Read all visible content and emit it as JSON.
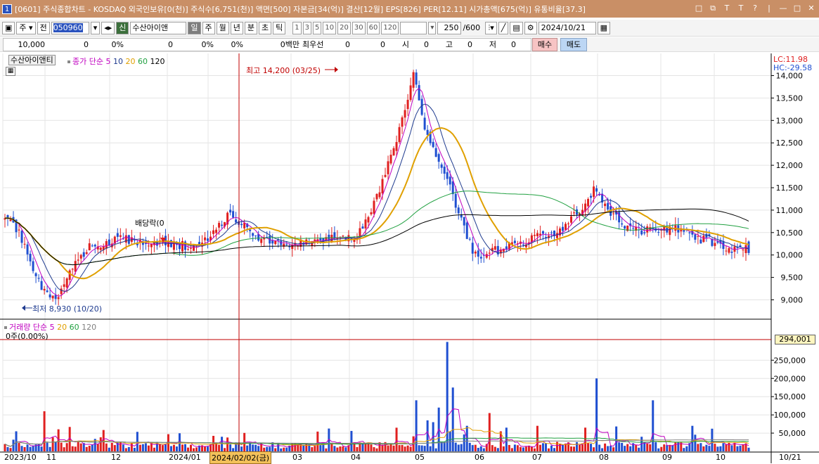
{
  "titlebar": {
    "icon_label": "1",
    "title": "[0601] 주식종합차트 - KOSDAQ 외국인보유[0(천)] 주식수[6,751(천)] 액면[500] 자본금[34(억)] 결산[12월] EPS[826] PER[12.11] 시가총액[675(억)] 유통비율[37.3]",
    "controls": [
      "□",
      "⧉",
      "T",
      "T",
      "?",
      "|",
      "—",
      "□",
      "✕"
    ]
  },
  "toolbar": {
    "period_select": "주",
    "prev_label": "전",
    "code": "050960",
    "shin_label": "신",
    "stock_name": "수산아이앤",
    "tabs": [
      "일",
      "주",
      "월",
      "년",
      "분",
      "초",
      "틱"
    ],
    "active_tab": "일",
    "intervals": [
      "1",
      "3",
      "5",
      "10",
      "20",
      "30",
      "60",
      "120"
    ],
    "count": "250",
    "count_total": "/600",
    "date": "2024/10/21"
  },
  "infobar": {
    "price": "10,000",
    "change": "0",
    "rate": "0%",
    "v1": "0",
    "rate2": "0%",
    "rate3": "0%",
    "amount": "0백만",
    "priority_label": "최우선",
    "p1": "0",
    "p2": "0",
    "open_label": "시",
    "open": "0",
    "high_label": "고",
    "high": "0",
    "low_label": "저",
    "low": "0",
    "buy_label": "매수",
    "sell_label": "매도"
  },
  "price_panel": {
    "stock_label": "수산아이앤티",
    "ma_legend": {
      "prefix": "종가 단순",
      "periods": [
        "5",
        "10",
        "20",
        "60",
        "120"
      ]
    },
    "lc_label": "LC:11.98",
    "hc_label": "HC:-29.58",
    "high_annotation": "최고 14,200 (03/25)",
    "low_annotation": "최저 8,930 (10/20)",
    "dividend_label": "배당락(0"
  },
  "volume_panel": {
    "legend": {
      "prefix": "거래량 단순",
      "periods": [
        "5",
        "20",
        "60",
        "120"
      ]
    },
    "cursor_label": "0주(0.00%)",
    "current_value": "294,001"
  },
  "x_axis": {
    "labels": [
      "2023/10",
      "11",
      "12",
      "2024/01",
      "2024/02/02(금)",
      "03",
      "04",
      "05",
      "06",
      "07",
      "08",
      "09",
      "10"
    ],
    "right_label": "10/21"
  },
  "chart_data": {
    "type": "candlestick",
    "price_axis": {
      "ticks": [
        9000,
        9500,
        10000,
        10500,
        11000,
        11500,
        12000,
        12500,
        13000,
        13500,
        14000
      ],
      "tick_labels": [
        "9,000",
        "9,500",
        "10,000",
        "10,500",
        "11,000",
        "11,500",
        "12,000",
        "12,500",
        "13,000",
        "13,500",
        "14,000"
      ],
      "range": [
        8600,
        14400
      ]
    },
    "volume_axis": {
      "ticks": [
        50000,
        100000,
        150000,
        200000,
        250000
      ],
      "tick_labels": [
        "50,000",
        "100,000",
        "150,000",
        "200,000",
        "250,000"
      ],
      "range": [
        0,
        320000
      ]
    },
    "period": {
      "from": "2023/10",
      "to": "2024/10/21"
    },
    "high": {
      "value": 14200,
      "date": "03/25"
    },
    "low": {
      "value": 8930,
      "date": "10/20"
    },
    "moving_averages": [
      "5",
      "10",
      "20",
      "60",
      "120"
    ],
    "colors": {
      "up": "#e02020",
      "down": "#1f4fd1",
      "ma5": "#c000c0",
      "ma10": "#1f3b8f",
      "ma20": "#e0a000",
      "ma60": "#20a040",
      "ma120": "#000000",
      "crosshair": "#c00000"
    }
  }
}
